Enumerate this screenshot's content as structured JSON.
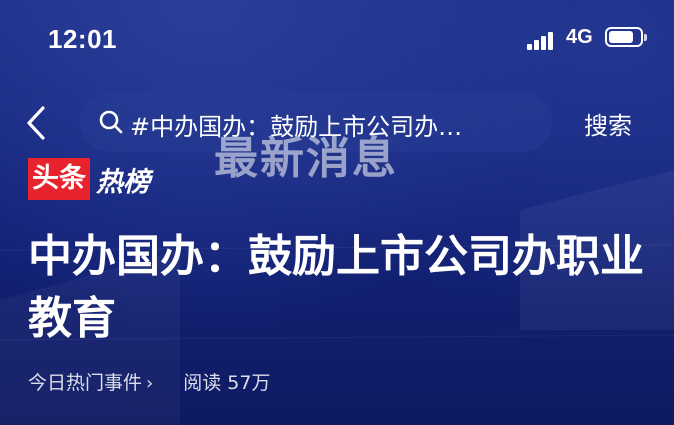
{
  "status_bar": {
    "time": "12:01",
    "network": "4G"
  },
  "search": {
    "query": "#中办国办：鼓励上市公司办…",
    "button_label": "搜索"
  },
  "watermark": {
    "text": "最新消息"
  },
  "brand": {
    "part1": "头条",
    "part2": "热榜"
  },
  "article": {
    "title": "中办国办：鼓励上市公司办职业教育",
    "category": "今日热门事件",
    "reads": "阅读 57万"
  },
  "icons": [
    "back-icon",
    "search-icon",
    "signal-icon",
    "battery-icon",
    "chevron-right-icon"
  ]
}
